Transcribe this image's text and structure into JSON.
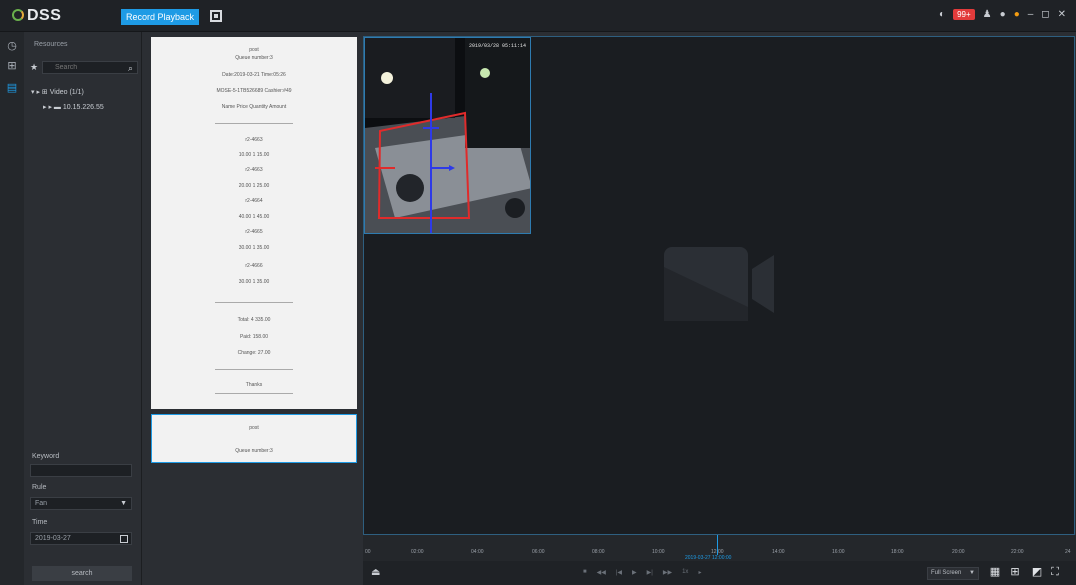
{
  "app": {
    "logo": "DSS",
    "active_tab": "Record Playback",
    "alarm_badge": "99+"
  },
  "left_nav": {
    "icons": [
      "history-icon",
      "grid-view-icon",
      "device-list-icon"
    ]
  },
  "tree": {
    "title": "Resources",
    "search_placeholder": "Search",
    "root_node": "Video (1/1)",
    "child_node": "10.15.226.55"
  },
  "filter": {
    "keyword_label": "Keyword",
    "keyword_value": "",
    "rule_label": "Rule",
    "rule_value": "Fan",
    "time_label": "Time",
    "time_value": "2019-03-27",
    "search_button": "search"
  },
  "receipt": {
    "header": "post",
    "queue": "Queue number:3",
    "date": "Date:2019-03-21 Time:05:26",
    "model": "MOSE-5-1TB526689 Cashier:#49",
    "columns": "Name Price Quantity Amount",
    "items": [
      "r2-4663",
      "10.00 1 15.00",
      "r2-4663",
      "20.00 1 25.00",
      "r2-4664",
      "40.00 1 45.00",
      "r2-4665",
      "30.00 1 35.00",
      "r2-4666",
      "30.00 1 35.00"
    ],
    "total": "Total: 4 335.00",
    "paid": "Paid: 158.00",
    "change": "Change: 27.00",
    "thanks": "Thanks"
  },
  "receipt2": {
    "header": "post",
    "queue": "Queue number:3"
  },
  "video": {
    "timestamp": "2019/03/28 05:11:14"
  },
  "timeline": {
    "ticks": [
      "00",
      "02:00",
      "04:00",
      "06:00",
      "08:00",
      "10:00",
      "12:00",
      "14:00",
      "16:00",
      "18:00",
      "20:00",
      "22:00",
      "24"
    ],
    "cursor_label": "2019-03-27 12:00:00"
  },
  "bottom": {
    "speed": "1x",
    "fullscreen_label": "Full Screen"
  },
  "colors": {
    "accent": "#1e9be5",
    "background": "#2b2e33",
    "alarm": "#e23b3b"
  }
}
